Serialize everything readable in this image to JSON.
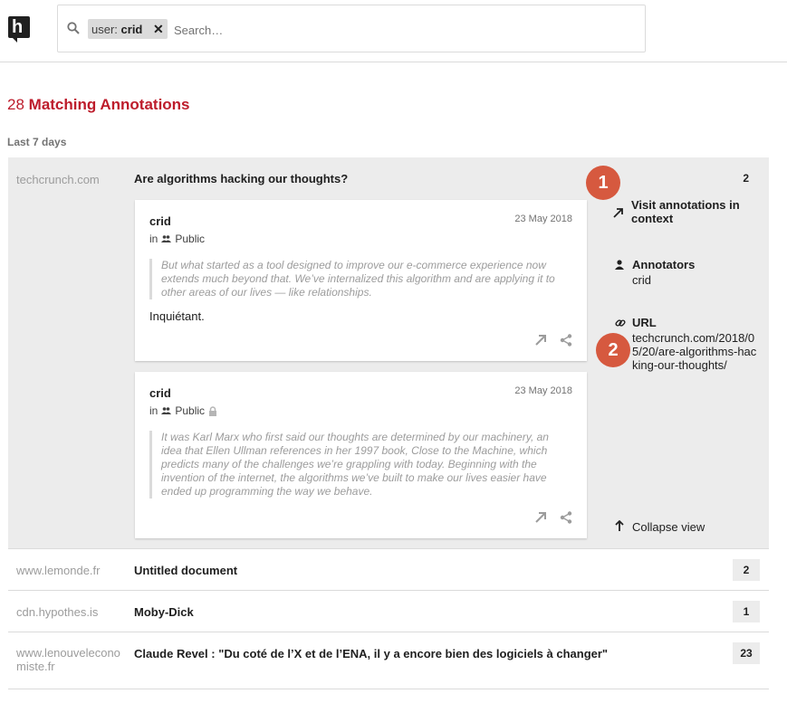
{
  "search": {
    "chip_key": "user:",
    "chip_value": "crid",
    "placeholder": "Search…"
  },
  "results": {
    "count": "28",
    "label": "Matching Annotations",
    "period": "Last 7 days"
  },
  "expanded": {
    "domain": "techcrunch.com",
    "title": "Are algorithms hacking our thoughts?",
    "count": "2",
    "annotations": [
      {
        "user": "crid",
        "date": "23 May 2018",
        "group_prefix": "in",
        "group": "Public",
        "quote": "But what started as a tool designed to improve our e-commerce experience now extends much beyond that. We’ve internalized this algorithm and are applying it to other areas of our lives — like relationships.",
        "text": "Inquiétant."
      },
      {
        "user": "crid",
        "date": "23 May 2018",
        "group_prefix": "in",
        "group": "Public",
        "quote": "It was Karl Marx who first said our thoughts are determined by our machinery, an idea that Ellen Ullman references in her 1997 book, Close to the Machine, which predicts many of the challenges we’re grappling with today. Beginning with the invention of the internet, the algorithms we’ve built to make our lives easier have ended up programming the way we behave.",
        "text": ""
      }
    ],
    "sidebar": {
      "visit_line1": "Visit annotations in",
      "visit_line2": "context",
      "annotators_label": "Annotators",
      "annotators_value": "crid",
      "url_label": "URL",
      "url_line1": "techcrunch.com/2018/0",
      "url_line2": "5/20/are-algorithms-hac",
      "url_line3": "king-our-thoughts/",
      "collapse_label": "Collapse view"
    },
    "markers": [
      "1",
      "2"
    ]
  },
  "rows": [
    {
      "domain": "www.lemonde.fr",
      "domain2": "",
      "title": "Untitled document",
      "count": "2"
    },
    {
      "domain": "cdn.hypothes.is",
      "domain2": "",
      "title": "Moby-Dick",
      "count": "1"
    },
    {
      "domain": "www.lenouveleconomiste.fr",
      "domain_line1": "www.lenouvelecono",
      "domain_line2": "miste.fr",
      "title": "Claude Revel : \"Du coté de l’X et de l’ENA, il y a encore bien des logiciels à changer\"",
      "count": "23"
    }
  ],
  "colors": {
    "brand": "#bd1c2b",
    "marker": "#d6593f",
    "expanded_bg": "#ececec"
  }
}
